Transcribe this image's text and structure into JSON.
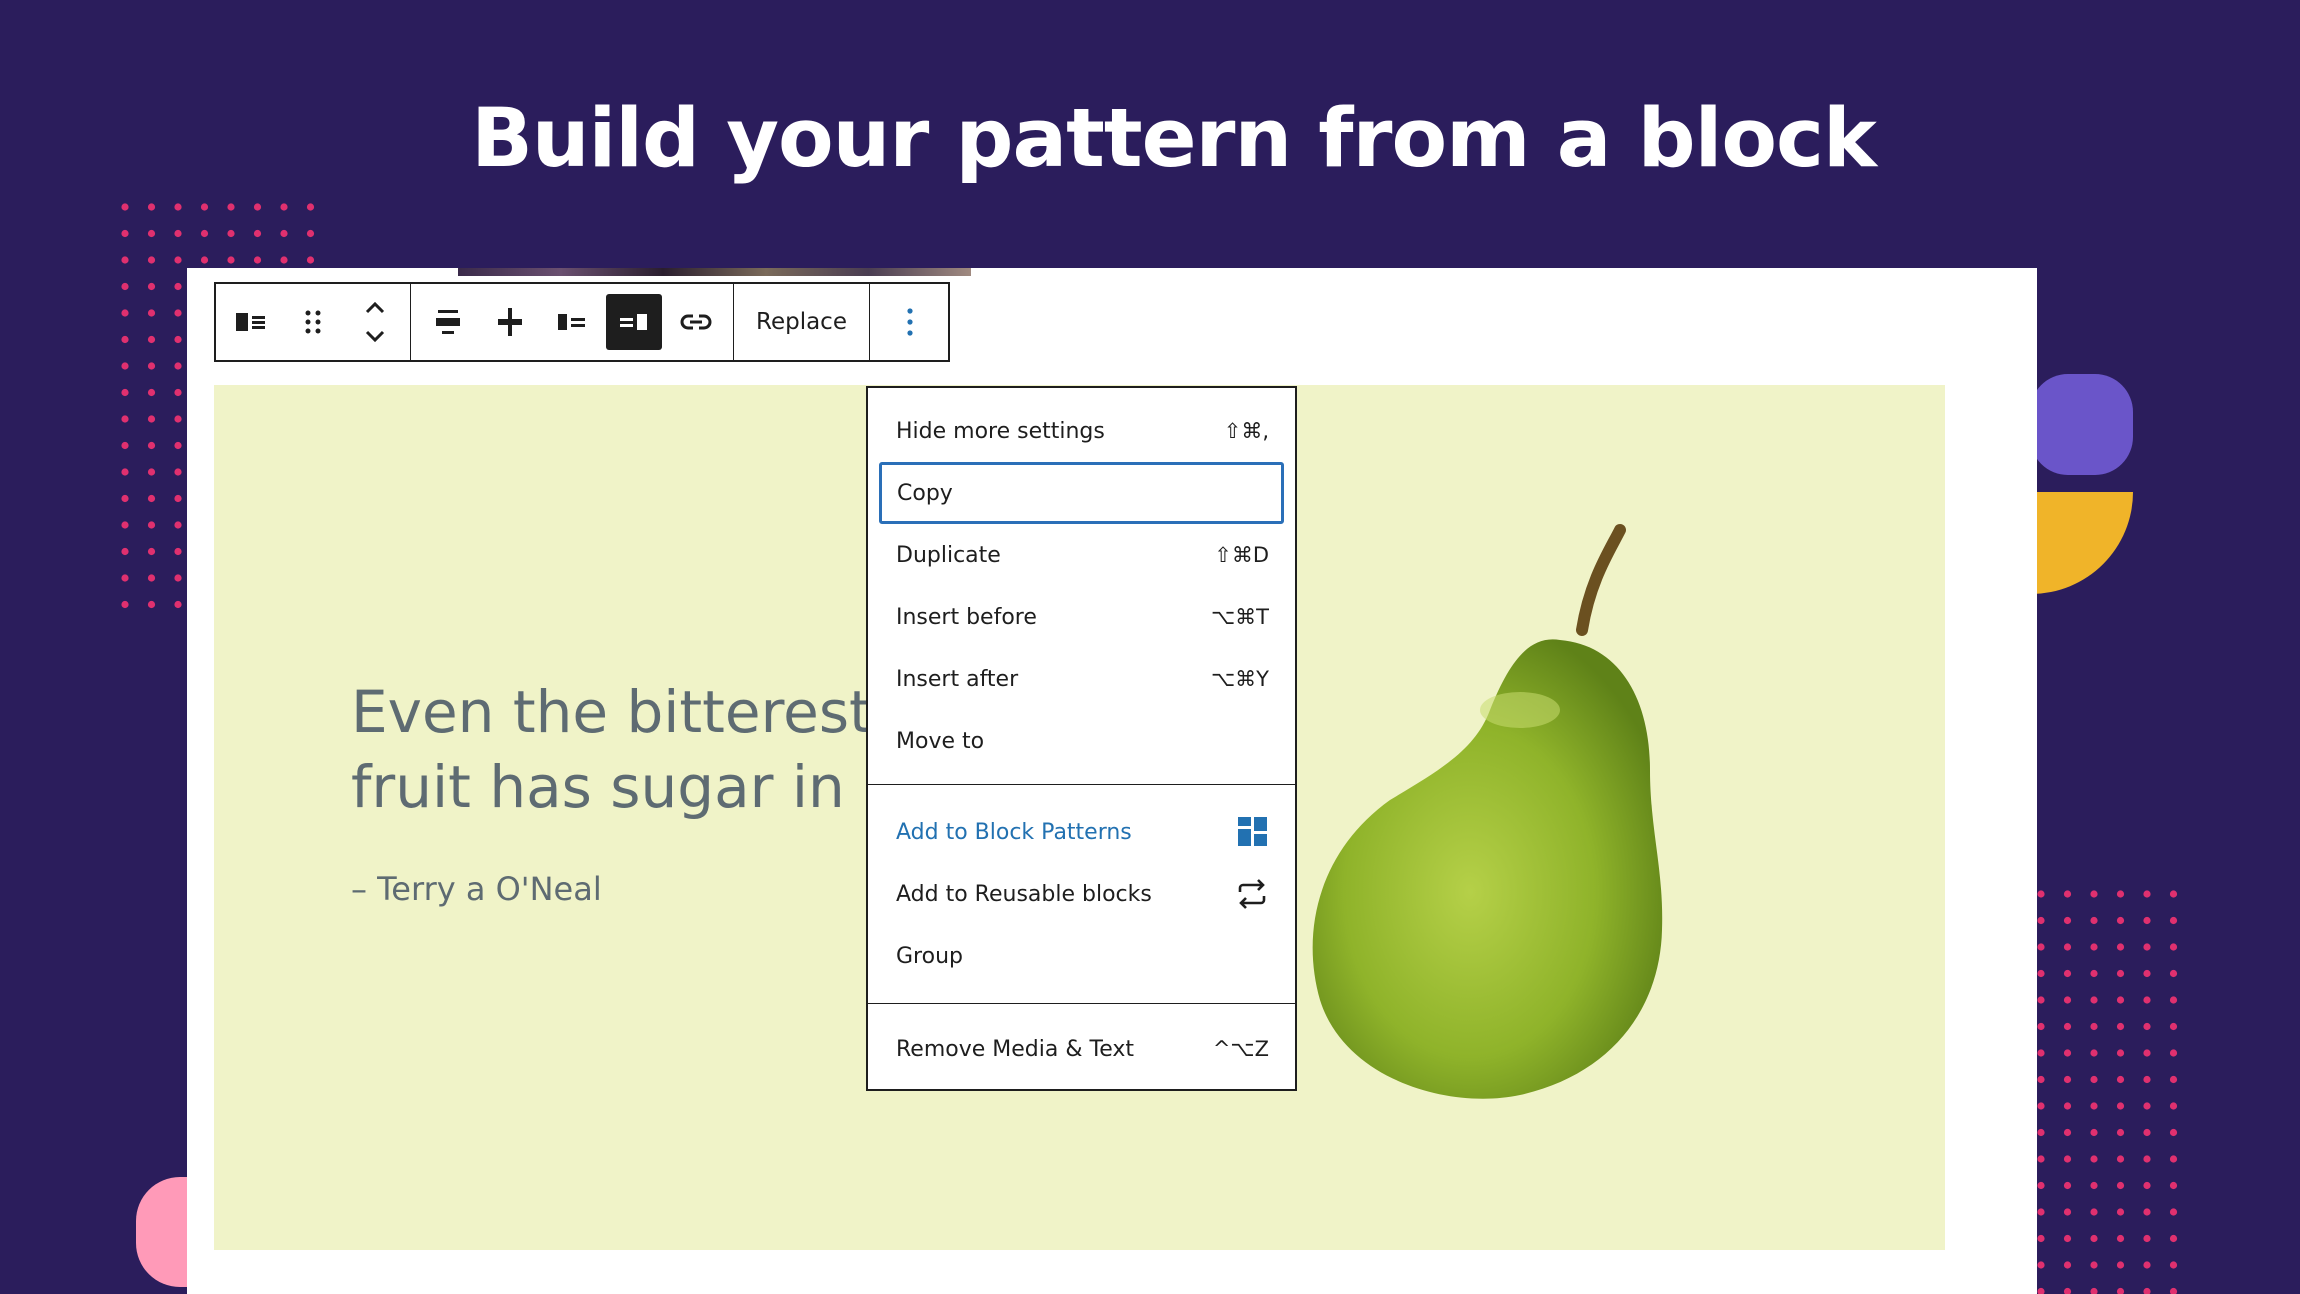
{
  "headline": "Build your pattern from a block",
  "quote": {
    "line1": "Even the bitterest",
    "line2": "fruit has sugar in it",
    "citation": "– Terry a O'Neal"
  },
  "toolbar": {
    "replace_label": "Replace",
    "icons": [
      "media-text-block-icon",
      "drag-handle-icon",
      "move-up-down-icon",
      "align-top-icon",
      "align-center-icon",
      "media-left-icon",
      "media-right-icon",
      "link-icon",
      "more-options-icon"
    ]
  },
  "menu": {
    "sections": [
      {
        "items": [
          {
            "label": "Hide more settings",
            "shortcut": "⇧⌘,"
          },
          {
            "label": "Copy",
            "shortcut": ""
          },
          {
            "label": "Duplicate",
            "shortcut": "⇧⌘D"
          },
          {
            "label": "Insert before",
            "shortcut": "⌥⌘T"
          },
          {
            "label": "Insert after",
            "shortcut": "⌥⌘Y"
          },
          {
            "label": "Move to",
            "shortcut": ""
          }
        ]
      },
      {
        "items": [
          {
            "label": "Add to Block Patterns",
            "icon": "block-patterns-icon"
          },
          {
            "label": "Add to Reusable blocks",
            "icon": "reusable-block-icon"
          },
          {
            "label": "Group",
            "shortcut": ""
          }
        ]
      },
      {
        "items": [
          {
            "label": "Remove Media & Text",
            "shortcut": "^⌥Z"
          }
        ]
      }
    ]
  },
  "colors": {
    "background": "#2b1d5c",
    "accent_pink": "#e0306f",
    "accent_purple": "#6a55c9",
    "accent_yellow": "#f0b429",
    "media_background": "#f0f3c8",
    "link_blue": "#2271b1"
  }
}
